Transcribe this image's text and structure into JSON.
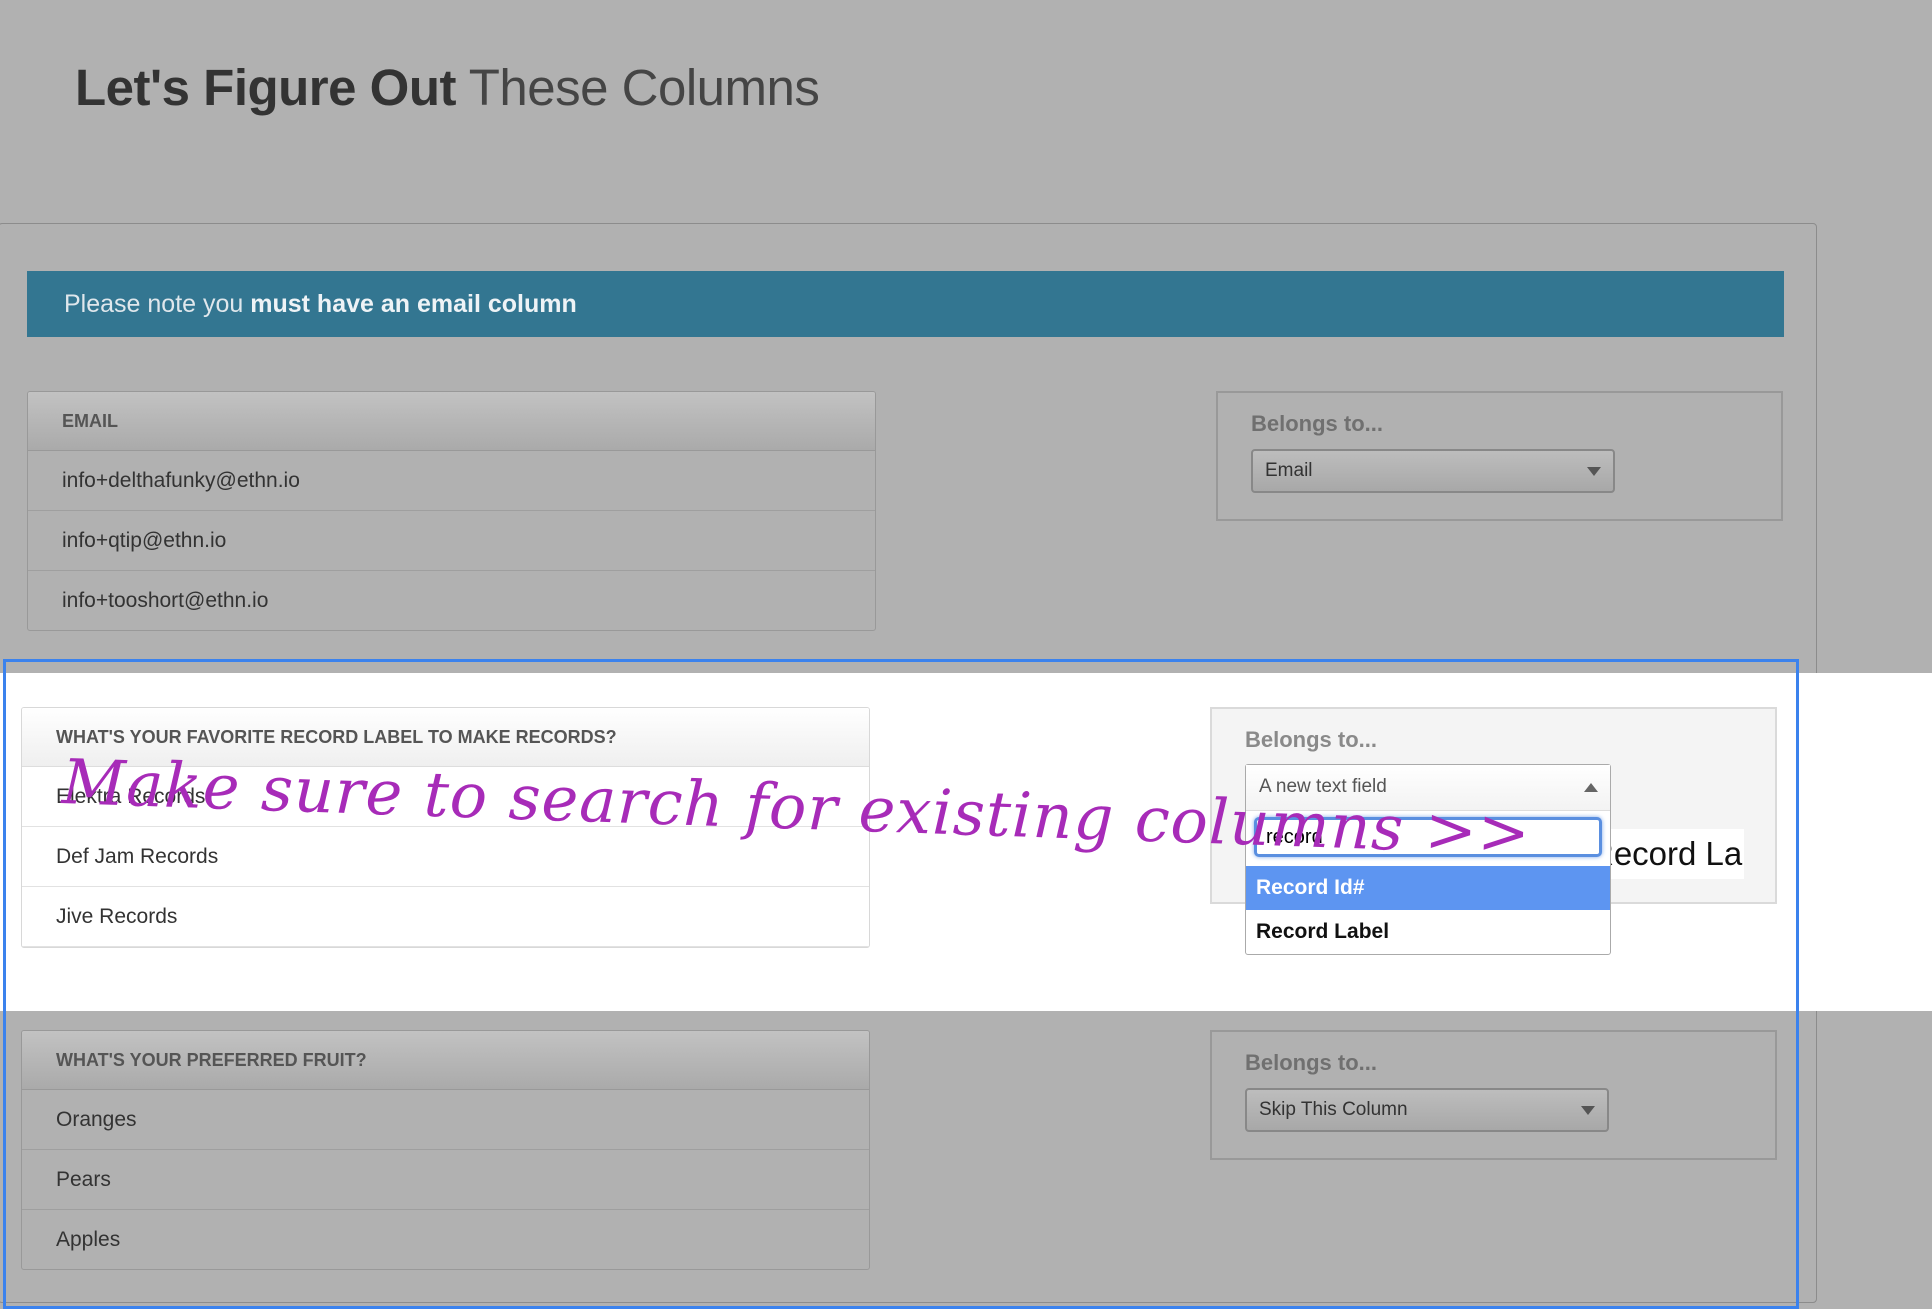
{
  "page": {
    "title_bold": "Let's Figure Out",
    "title_rest": "These Columns"
  },
  "notice": {
    "prefix": "Please note you ",
    "emphasis": "must have an email column"
  },
  "columns": [
    {
      "header": "EMAIL",
      "rows": [
        "info+delthafunky@ethn.io",
        "info+qtip@ethn.io",
        "info+tooshort@ethn.io"
      ],
      "belongs_label": "Belongs to...",
      "selected": "Email"
    },
    {
      "header": "WHAT'S YOUR FAVORITE RECORD LABEL TO MAKE RECORDS?",
      "rows": [
        "Elektra Records",
        "Def Jam Records",
        "Jive Records"
      ],
      "belongs_label": "Belongs to...",
      "selected": "A new text field",
      "dropdown": {
        "open": true,
        "search_value": "record",
        "options": [
          "Record Id#",
          "Record Label"
        ],
        "highlighted_option": "Record Id#"
      }
    },
    {
      "header": "WHAT'S YOUR PREFERRED FRUIT?",
      "rows": [
        "Oranges",
        "Pears",
        "Apples"
      ],
      "belongs_label": "Belongs to...",
      "selected": "Skip This Column"
    }
  ],
  "peek_text": "Record La",
  "annotation": "Make sure to search for existing columns >>",
  "colors": {
    "notice_bar": "#337691",
    "annotation": "#a72bb8",
    "focus_outline": "#3b82ed",
    "selected_option": "#5d95f1",
    "overlay_gray": "#b1b1b1"
  }
}
